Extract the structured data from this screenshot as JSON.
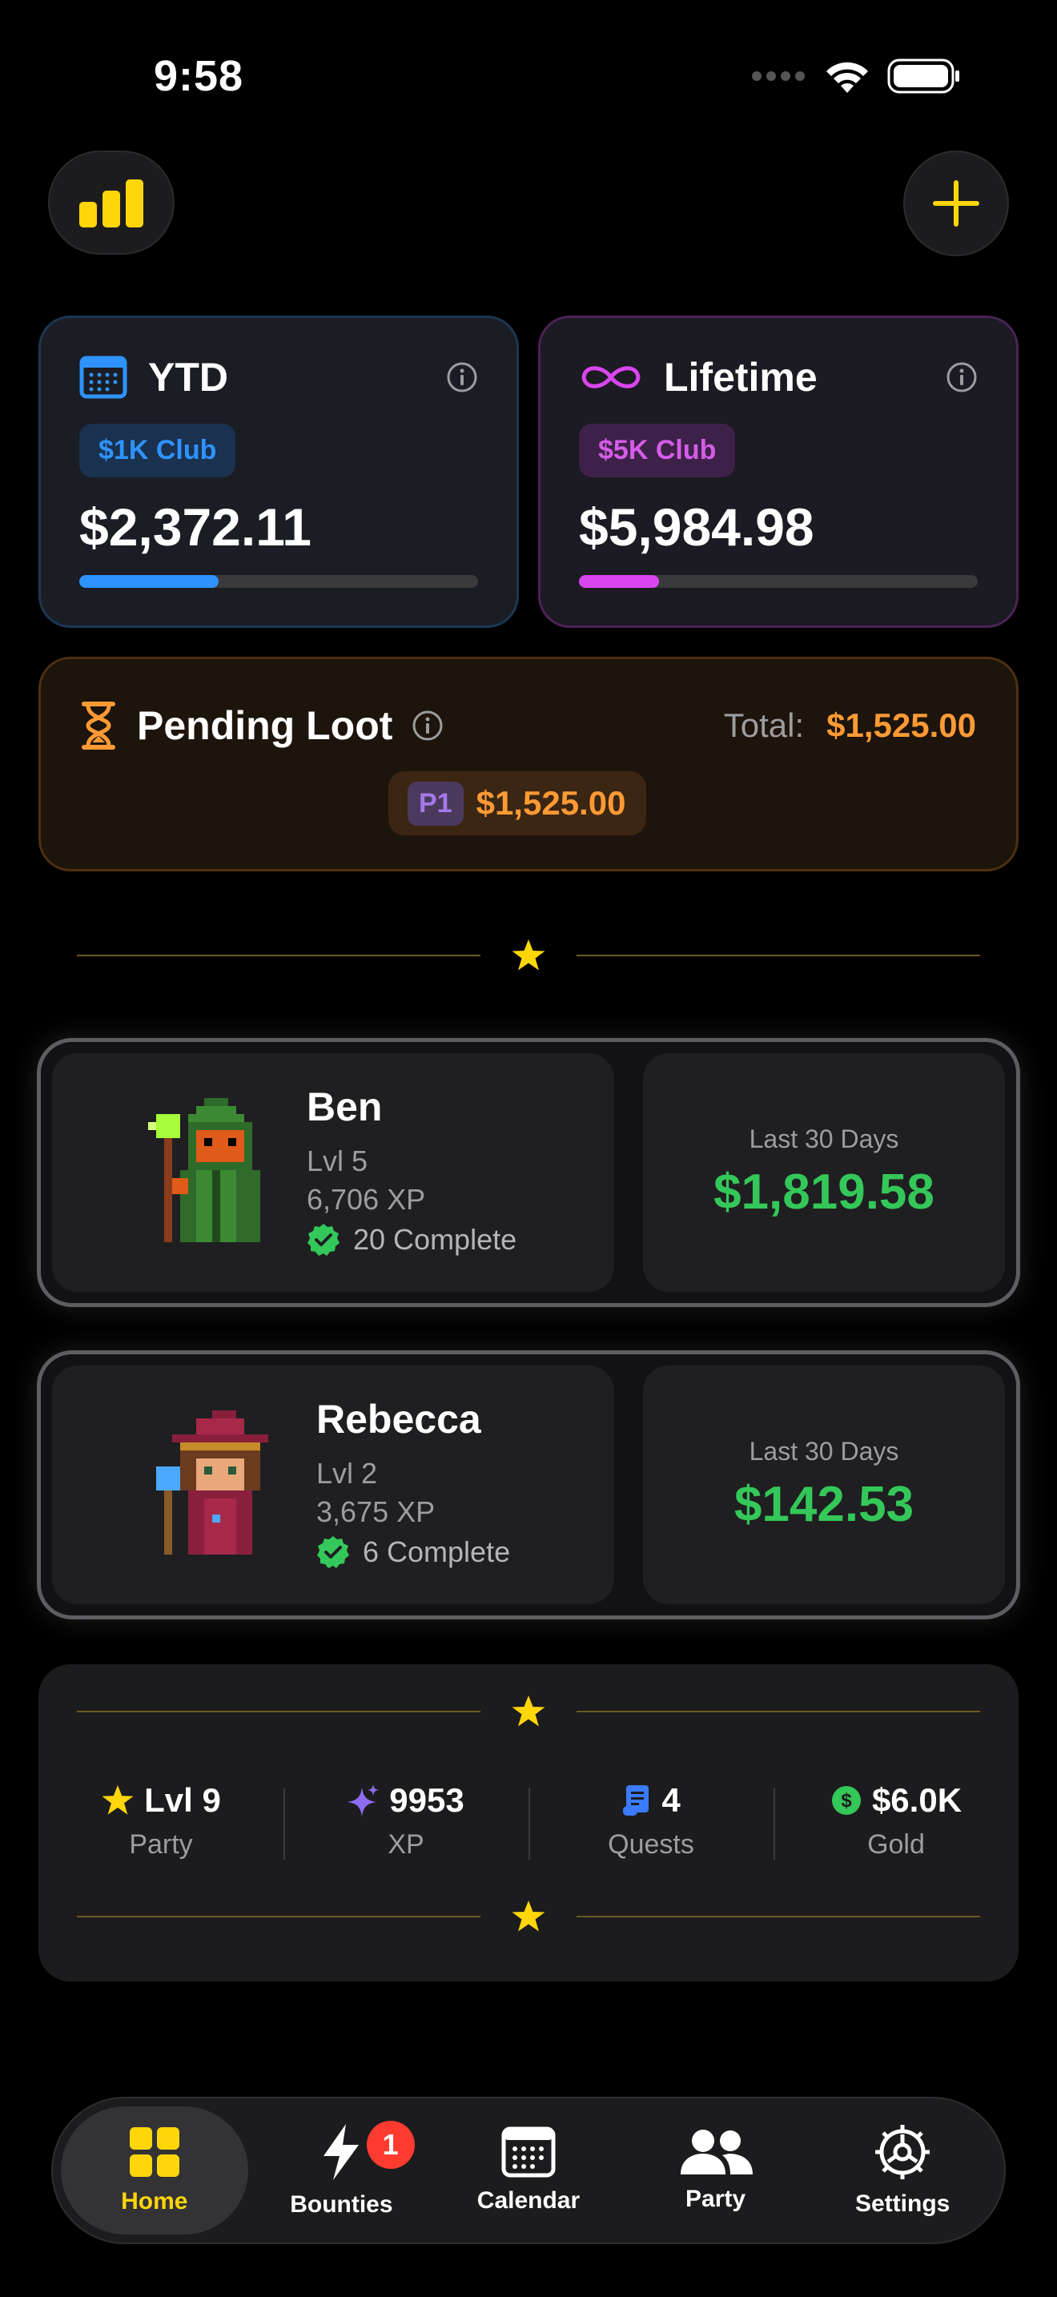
{
  "status": {
    "time": "9:58"
  },
  "colors": {
    "accent": "#ffd60a",
    "ytd": "#2e93ff",
    "lifetime": "#d946ef",
    "loot": "#ff9a35",
    "money": "#34c759"
  },
  "ytd": {
    "title": "YTD",
    "club": "$1K Club",
    "amount": "$2,372.11",
    "progress": 0.35
  },
  "lifetime": {
    "title": "Lifetime",
    "club": "$5K Club",
    "amount": "$5,984.98",
    "progress": 0.2
  },
  "pending": {
    "title": "Pending Loot",
    "total_label": "Total:",
    "total": "$1,525.00",
    "chip_tag": "P1",
    "chip_amount": "$1,525.00"
  },
  "members": [
    {
      "name": "Ben",
      "level": "Lvl 5",
      "xp": "6,706 XP",
      "complete": "20 Complete",
      "period": "Last 30 Days",
      "amount": "$1,819.58"
    },
    {
      "name": "Rebecca",
      "level": "Lvl 2",
      "xp": "3,675 XP",
      "complete": "6 Complete",
      "period": "Last 30 Days",
      "amount": "$142.53"
    }
  ],
  "party_stats": [
    {
      "value": "Lvl 9",
      "label": "Party",
      "icon": "star-icon"
    },
    {
      "value": "9953",
      "label": "XP",
      "icon": "sparkle-icon"
    },
    {
      "value": "4",
      "label": "Quests",
      "icon": "scroll-icon"
    },
    {
      "value": "$6.0K",
      "label": "Gold",
      "icon": "coin-icon"
    }
  ],
  "tabs": [
    {
      "label": "Home",
      "icon": "grid-icon"
    },
    {
      "label": "Bounties",
      "icon": "bolt-icon",
      "badge": "1"
    },
    {
      "label": "Calendar",
      "icon": "calendar-icon"
    },
    {
      "label": "Party",
      "icon": "people-icon"
    },
    {
      "label": "Settings",
      "icon": "gear-icon"
    }
  ]
}
